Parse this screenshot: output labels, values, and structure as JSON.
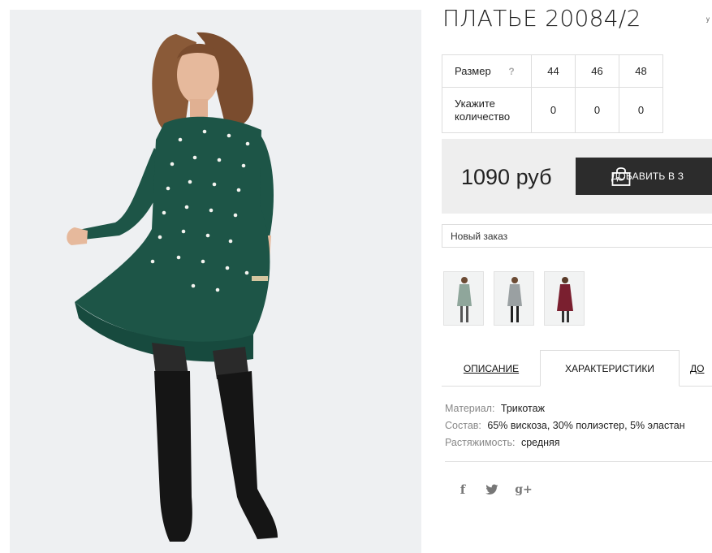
{
  "product": {
    "title": "ПЛАТЬЕ 20084/2",
    "title_side_mark": "ʸ"
  },
  "sizes": {
    "size_label": "Размер",
    "help_symbol": "?",
    "values": [
      "44",
      "46",
      "48"
    ],
    "quantity_label_line1": "Укажите",
    "quantity_label_line2": "количество",
    "quantities": [
      "0",
      "0",
      "0"
    ]
  },
  "purchase": {
    "price": "1090 руб",
    "add_to_cart_label": "ДОБАВИТЬ В З",
    "order_select_value": "Новый заказ"
  },
  "thumbnails": [
    {
      "name": "grey-green dress variant"
    },
    {
      "name": "grey dress variant"
    },
    {
      "name": "burgundy dress variant"
    }
  ],
  "tabs": {
    "description": "ОПИСАНИЕ",
    "characteristics": "ХАРАКТЕРИСТИКИ",
    "more": "ДО"
  },
  "specs": [
    {
      "key": "Материал:",
      "value": "Трикотаж"
    },
    {
      "key": "Состав:",
      "value": "65% вискоза, 30% полиэстер, 5% эластан"
    },
    {
      "key": "Растяжимость:",
      "value": "средняя"
    }
  ],
  "social": {
    "facebook": "f",
    "twitter": "t",
    "googleplus": "g+"
  },
  "colors": {
    "dress": "#1d5547",
    "button": "#2c2c2c",
    "price_bg": "#eeeeee",
    "photo_bg": "#eef0f2"
  }
}
